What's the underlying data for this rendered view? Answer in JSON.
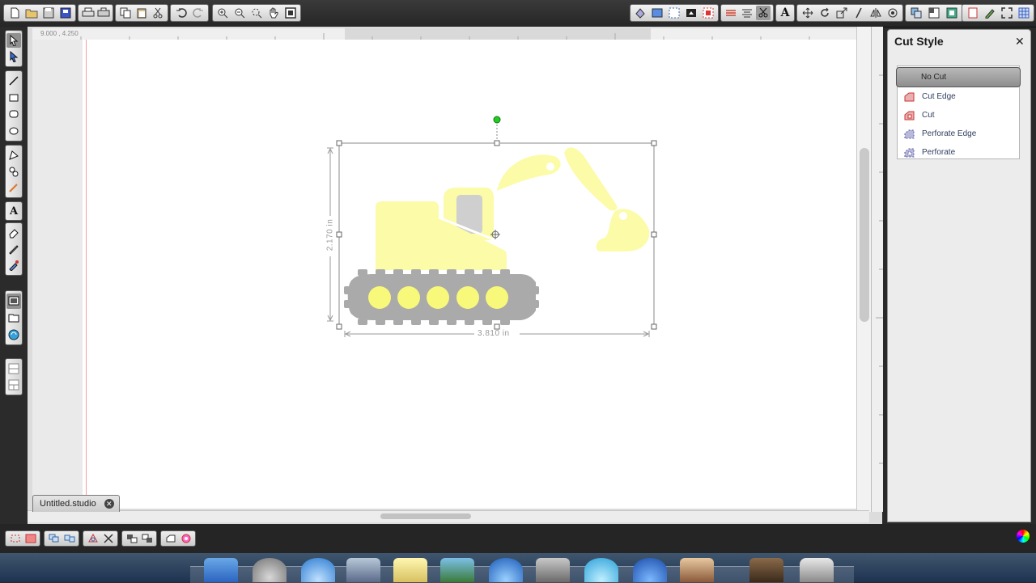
{
  "document": {
    "tab_label": "Untitled.studio",
    "coordinates": "9.000 , 4.250",
    "width_label": "3.810 in",
    "height_label": "2.170 in"
  },
  "cut_panel": {
    "title": "Cut Style",
    "options": [
      {
        "label": "No Cut",
        "selected": true,
        "icon": "no-cut-icon"
      },
      {
        "label": "Cut Edge",
        "selected": false,
        "icon": "cut-edge-icon"
      },
      {
        "label": "Cut",
        "selected": false,
        "icon": "cut-icon"
      },
      {
        "label": "Perforate Edge",
        "selected": false,
        "icon": "perforate-edge-icon"
      },
      {
        "label": "Perforate",
        "selected": false,
        "icon": "perforate-icon"
      }
    ]
  },
  "colors": {
    "excavator_body": "#fbfba8",
    "track": "#aaaaaa",
    "wheel": "#f8f87a",
    "selection": "#888888",
    "rotate_handle": "#22cc22",
    "cut_line": "#f1a0a0"
  }
}
